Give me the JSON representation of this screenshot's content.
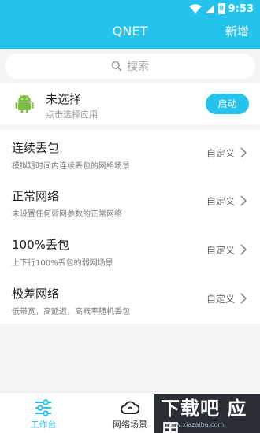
{
  "status_bar": {
    "time": "9:53",
    "battery": "8"
  },
  "header": {
    "title": "QNET",
    "add_label": "新增"
  },
  "search": {
    "placeholder": "搜索"
  },
  "app": {
    "name": "未选择",
    "hint": "点击选择应用",
    "start_label": "启动"
  },
  "scenes": [
    {
      "title": "连续丢包",
      "desc": "模拟短时间内连续丢包的网络场景",
      "value": "自定义"
    },
    {
      "title": "正常网络",
      "desc": "未设置任何弱网参数的正常网络",
      "value": "自定义"
    },
    {
      "title": "100%丢包",
      "desc": "上下行100%丢包的弱网场景",
      "value": "自定义"
    },
    {
      "title": "极差网络",
      "desc": "低带宽，高延迟，高概率随机丢包",
      "value": "自定义"
    }
  ],
  "tabs": [
    {
      "label": "工作台",
      "icon": "sliders-icon",
      "active": true
    },
    {
      "label": "网络场景",
      "icon": "cloud-icon",
      "active": false
    }
  ],
  "watermark": {
    "main": "下载吧 应用",
    "sub": "www.xiazaiba.com"
  },
  "colors": {
    "accent": "#23c3ee",
    "android": "#7fbd41"
  }
}
